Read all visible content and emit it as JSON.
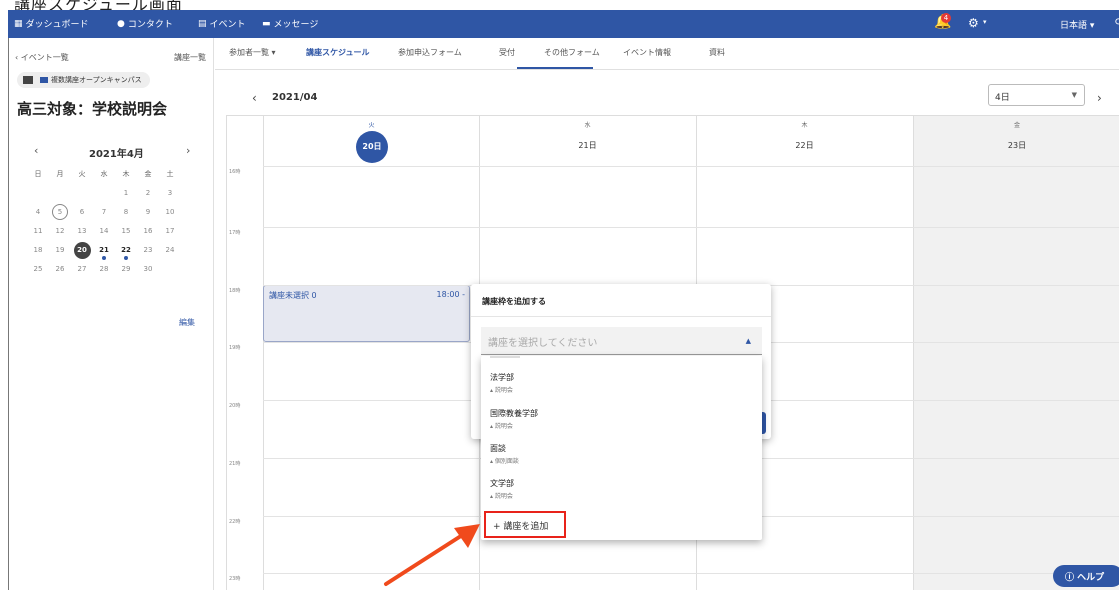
{
  "top_caption": "講座スケジュール画面",
  "nav": {
    "items": [
      {
        "icon": "grid-icon",
        "label": "ダッシュボード"
      },
      {
        "icon": "person-icon",
        "label": "コンタクト"
      },
      {
        "icon": "calendar-icon",
        "label": "イベント"
      },
      {
        "icon": "message-icon",
        "label": "メッセージ"
      }
    ],
    "notification_count": "4",
    "language": "日本語 ▾"
  },
  "sidebar": {
    "back_link": "‹ イベント一覧",
    "course_list_link": "講座一覧",
    "chip": "複数講座オープンキャンパス",
    "event_title": "高三対象：学校説明会",
    "mini_calendar": {
      "month": "2021年4月",
      "weekday_headers": [
        "日",
        "月",
        "火",
        "水",
        "木",
        "金",
        "土"
      ],
      "weeks": [
        [
          "",
          "",
          "",
          "",
          "1",
          "2",
          "3"
        ],
        [
          "4",
          "5",
          "6",
          "7",
          "8",
          "9",
          "10"
        ],
        [
          "11",
          "12",
          "13",
          "14",
          "15",
          "16",
          "17"
        ],
        [
          "18",
          "19",
          "20",
          "21",
          "22",
          "23",
          "24"
        ],
        [
          "25",
          "26",
          "27",
          "28",
          "29",
          "30",
          ""
        ]
      ],
      "outlined_day": "5",
      "selected_day": "20",
      "event_days": [
        "21",
        "22"
      ]
    },
    "edit_link": "編集"
  },
  "tabs": [
    {
      "label": "参加者一覧 ▾",
      "active": false
    },
    {
      "label": "講座スケジュール",
      "active": true
    },
    {
      "label": "参加申込フォーム",
      "active": false
    },
    {
      "label": "受付",
      "active": false
    },
    {
      "label": "その他フォーム",
      "active": false
    },
    {
      "label": "イベント情報",
      "active": false
    },
    {
      "label": "資料",
      "active": false
    }
  ],
  "calendar": {
    "month_label": "2021/04",
    "range_value": "4日",
    "days": [
      {
        "dow": "火",
        "date": "20日",
        "today": true
      },
      {
        "dow": "水",
        "date": "21日",
        "today": false
      },
      {
        "dow": "木",
        "date": "22日",
        "today": false
      },
      {
        "dow": "金",
        "date": "23日",
        "today": false
      }
    ],
    "hours": [
      "16時",
      "17時",
      "18時",
      "19時",
      "20時",
      "21時",
      "22時",
      "23時"
    ],
    "event": {
      "title": "講座未選択 0",
      "time": "18:00 -"
    }
  },
  "dialog": {
    "title": "講座枠を追加する",
    "select_placeholder": "講座を選択してください"
  },
  "dropdown": {
    "items": [
      {
        "name": "法学部",
        "sub": "説明会"
      },
      {
        "name": "国際教養学部",
        "sub": "説明会"
      },
      {
        "name": "面談",
        "sub": "個別面談"
      },
      {
        "name": "文学部",
        "sub": "説明会"
      }
    ],
    "add_label": "+ 講座を追加"
  },
  "help_label": "ヘルプ",
  "colors": {
    "brand": "#2f56a5",
    "highlight": "#e8231a",
    "arrow": "#f04a1c"
  }
}
